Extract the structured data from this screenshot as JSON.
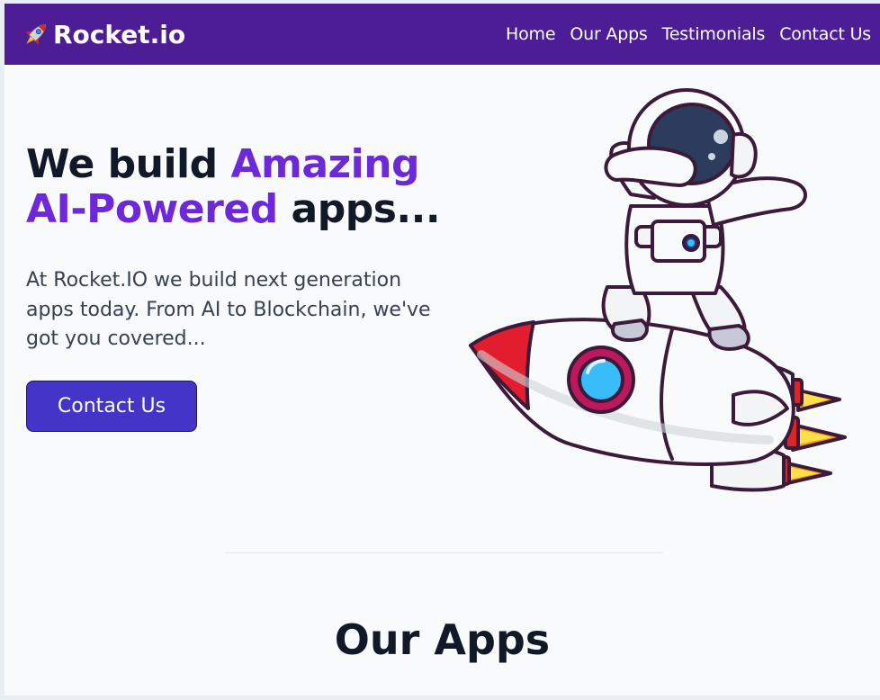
{
  "nav": {
    "brand": "Rocket.io",
    "links": [
      {
        "label": "Home"
      },
      {
        "label": "Our Apps"
      },
      {
        "label": "Testimonials"
      },
      {
        "label": "Contact Us"
      }
    ]
  },
  "hero": {
    "title_part1": "We build ",
    "title_accent1": "Amazing",
    "title_accent2": "AI-Powered",
    "title_part2": " apps...",
    "description": "At Rocket.IO we build next generation apps today. From AI to Blockchain, we've got you covered...",
    "cta_label": "Contact Us",
    "illustration": "astronaut-on-rocket"
  },
  "section": {
    "title": "Our Apps"
  },
  "colors": {
    "nav_bg": "#4c1d95",
    "accent": "#6d28d9",
    "button": "#4434c8",
    "page_bg": "#f8fafc"
  }
}
